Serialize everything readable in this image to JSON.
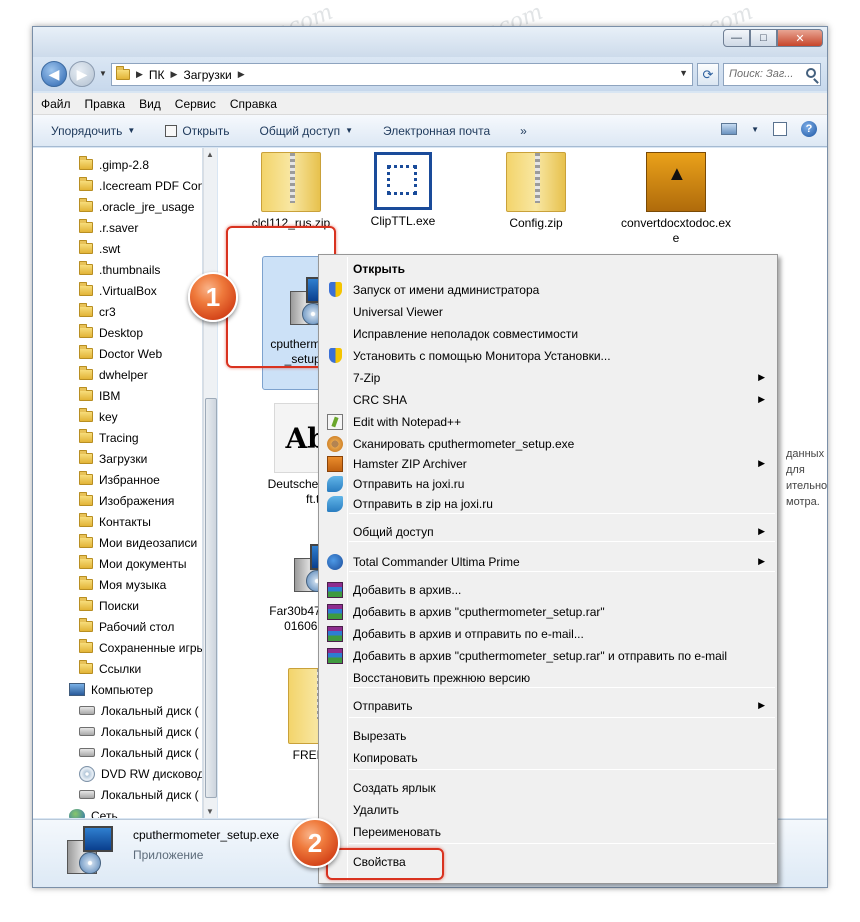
{
  "window": {
    "buttons": {
      "minimize": "—",
      "maximize": "□",
      "close": "✕"
    }
  },
  "nav": {
    "back_glyph": "◀",
    "forward_glyph": "▶",
    "breadcrumb": [
      "ПК",
      "Загрузки"
    ],
    "search_placeholder": "Поиск: Заг..."
  },
  "menubar": [
    "Файл",
    "Правка",
    "Вид",
    "Сервис",
    "Справка"
  ],
  "toolbar": {
    "items": [
      "Упорядочить",
      "Открыть",
      "Общий доступ",
      "Электронная почта"
    ],
    "more": "»"
  },
  "sidebar": {
    "items": [
      {
        "label": ".gimp-2.8",
        "icon": "folder-icon"
      },
      {
        "label": ".Icecream PDF Con",
        "icon": "folder-icon"
      },
      {
        "label": ".oracle_jre_usage",
        "icon": "folder-icon"
      },
      {
        "label": ".r.saver",
        "icon": "folder-icon"
      },
      {
        "label": ".swt",
        "icon": "folder-icon"
      },
      {
        "label": ".thumbnails",
        "icon": "folder-icon"
      },
      {
        "label": ".VirtualBox",
        "icon": "folder-icon"
      },
      {
        "label": "cr3",
        "icon": "folder-icon"
      },
      {
        "label": "Desktop",
        "icon": "folder-icon"
      },
      {
        "label": "Doctor Web",
        "icon": "folder-icon"
      },
      {
        "label": "dwhelper",
        "icon": "folder-icon"
      },
      {
        "label": "IBM",
        "icon": "folder-icon"
      },
      {
        "label": "key",
        "icon": "folder-icon"
      },
      {
        "label": "Tracing",
        "icon": "folder-icon"
      },
      {
        "label": "Загрузки",
        "icon": "folder-icon"
      },
      {
        "label": "Избранное",
        "icon": "folder-icon"
      },
      {
        "label": "Изображения",
        "icon": "folder-icon"
      },
      {
        "label": "Контакты",
        "icon": "folder-icon"
      },
      {
        "label": "Мои видеозаписи",
        "icon": "folder-icon"
      },
      {
        "label": "Мои документы",
        "icon": "folder-icon"
      },
      {
        "label": "Моя музыка",
        "icon": "folder-icon"
      },
      {
        "label": "Поиски",
        "icon": "folder-icon"
      },
      {
        "label": "Рабочий стол",
        "icon": "folder-icon"
      },
      {
        "label": "Сохраненные игры",
        "icon": "folder-icon"
      },
      {
        "label": "Ссылки",
        "icon": "folder-icon"
      },
      {
        "label": "Компьютер",
        "icon": "computer-icon"
      },
      {
        "label": "Локальный диск (",
        "icon": "drive-icon"
      },
      {
        "label": "Локальный диск (",
        "icon": "drive-icon"
      },
      {
        "label": "Локальный диск (",
        "icon": "drive-icon"
      },
      {
        "label": "DVD RW дисковод",
        "icon": "dvd-icon"
      },
      {
        "label": "Локальный диск (",
        "icon": "drive-icon"
      },
      {
        "label": "Сеть",
        "icon": "network-icon"
      }
    ]
  },
  "files": {
    "clcl": "clcl112_rus.zip",
    "cliptl": "ClipTTL.exe",
    "config": "Config.zip",
    "convert": "convertdocxtodoc.exe",
    "cputherm": "cputhermometer_setup.exe",
    "deutsche": "DeutscheZierschrift.ttf",
    "far": "Far30b4700.x86.20160611.msi",
    "free": "FREE.zip",
    "font_preview": "Abg"
  },
  "details": {
    "name": "cputhermometer_setup.exe",
    "type": "Приложение"
  },
  "partial_right_text": [
    "данных",
    "для",
    "ительно",
    "мотра."
  ],
  "context_menu": {
    "items": [
      {
        "label": "Открыть",
        "bold": true,
        "icon": ""
      },
      {
        "label": "Запуск от имени администратора",
        "icon": "shield-icon"
      },
      {
        "label": "Universal Viewer",
        "icon": ""
      },
      {
        "label": "Исправление неполадок совместимости",
        "icon": ""
      },
      {
        "label": "Установить с помощью Монитора Установки...",
        "icon": "shield-icon"
      },
      {
        "label": "7-Zip",
        "submenu": true,
        "icon": ""
      },
      {
        "label": "CRC SHA",
        "submenu": true,
        "icon": ""
      },
      {
        "label": "Edit with Notepad++",
        "icon": "notepad-icon"
      },
      {
        "label": "Сканировать cputhermometer_setup.exe",
        "icon": "scan-icon"
      },
      {
        "label": "Hamster ZIP Archiver",
        "submenu": true,
        "icon": "hamster-icon"
      },
      {
        "label": "Отправить на joxi.ru",
        "icon": "joxi-icon"
      },
      {
        "label": "Отправить в zip на joxi.ru",
        "icon": "joxi-icon"
      },
      {
        "label": "Общий доступ",
        "submenu": true,
        "icon": ""
      },
      {
        "label": "Total Commander Ultima Prime",
        "submenu": true,
        "icon": "total-commander-icon"
      },
      {
        "label": "Добавить в архив...",
        "icon": "winrar-icon"
      },
      {
        "label": "Добавить в архив \"cputhermometer_setup.rar\"",
        "icon": "winrar-icon"
      },
      {
        "label": "Добавить в архив и отправить по e-mail...",
        "icon": "winrar-icon"
      },
      {
        "label": "Добавить в архив \"cputhermometer_setup.rar\" и отправить по e-mail",
        "icon": "winrar-icon"
      },
      {
        "label": "Восстановить прежнюю версию",
        "icon": ""
      },
      {
        "label": "Отправить",
        "submenu": true,
        "icon": ""
      },
      {
        "label": "Вырезать",
        "icon": ""
      },
      {
        "label": "Копировать",
        "icon": ""
      },
      {
        "label": "Создать ярлык",
        "icon": ""
      },
      {
        "label": "Удалить",
        "icon": ""
      },
      {
        "label": "Переименовать",
        "icon": ""
      },
      {
        "label": "Свойства",
        "icon": ""
      }
    ]
  },
  "badges": [
    "1",
    "2"
  ],
  "watermark": "Soringpcrepair.com",
  "colors": {
    "highlight_frame": "#d9321f",
    "badge": "#e0602a",
    "selection": "#cce1f7"
  }
}
